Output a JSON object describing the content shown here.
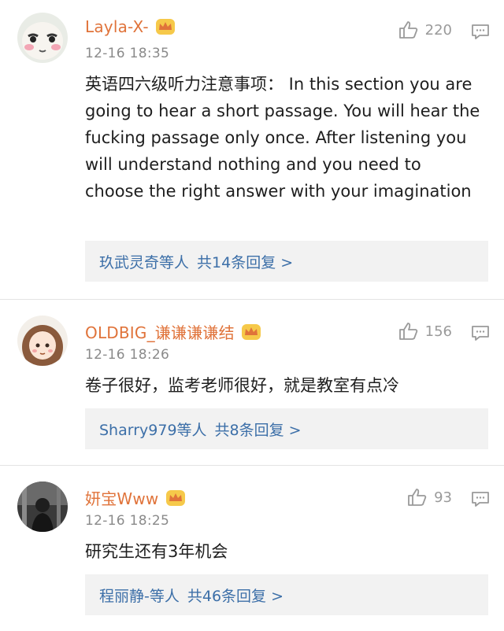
{
  "comments": [
    {
      "username": "Layla-X-",
      "time": "12-16 18:35",
      "likes": "220",
      "text": "英语四六级听力注意事项： In this section you are going to hear a short passage. You will hear the fucking passage only once. After listening you will understand nothing and you need to choose the right answer with your imagination",
      "reply_users": "玖武灵奇等人",
      "reply_count": "共14条回复 >",
      "vip_icon": "crown-vip-icon",
      "colors": {
        "username": "#e0733a",
        "link": "#3c6fa8"
      }
    },
    {
      "username": "OLDBIG_谦谦谦谦结",
      "time": "12-16 18:26",
      "likes": "156",
      "text": "卷子很好，监考老师很好，就是教室有点冷",
      "reply_users": "Sharry979等人",
      "reply_count": "共8条回复 >",
      "vip_icon": "crown-vip-icon"
    },
    {
      "username": "妍宝Www",
      "time": "12-16 18:25",
      "likes": "93",
      "text": "研究生还有3年机会",
      "reply_users": "程丽静-等人",
      "reply_count": "共46条回复 >",
      "vip_icon": "crown-vip-icon"
    }
  ]
}
